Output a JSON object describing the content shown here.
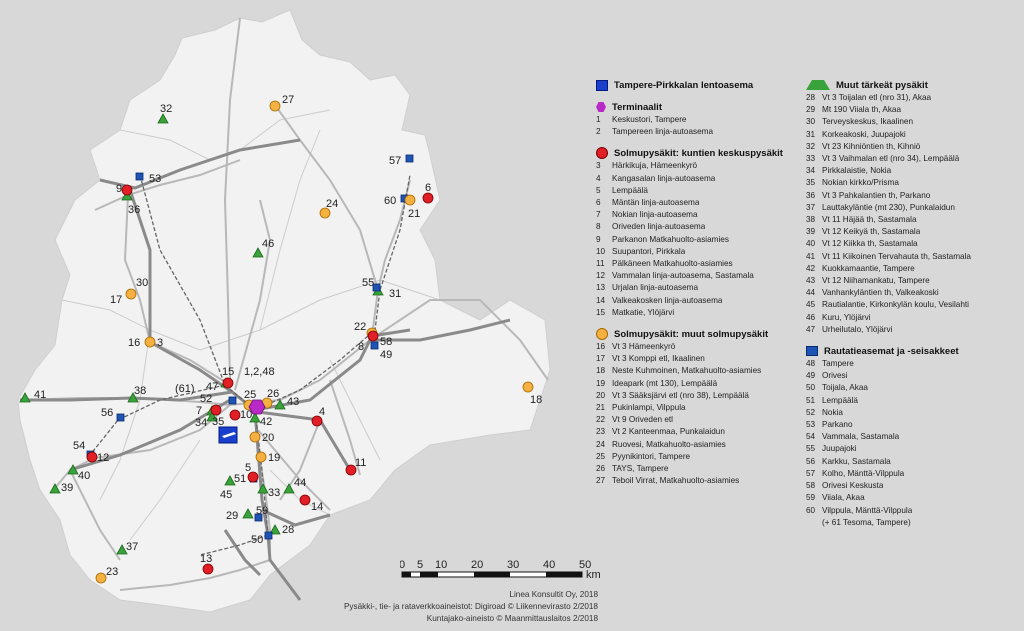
{
  "map": {
    "labels": {
      "n1_2_48": "1,2,48",
      "n61": "(61)",
      "n3": "3",
      "n4": "4",
      "n5": "5",
      "n6": "6",
      "n7": "7",
      "n8": "8",
      "n9": "9",
      "n10": "10",
      "n11": "11",
      "n12": "12",
      "n13": "13",
      "n14": "14",
      "n15": "15",
      "n16": "16",
      "n17": "17",
      "n18": "18",
      "n19": "19",
      "n20": "20",
      "n21": "21",
      "n22": "22",
      "n23": "23",
      "n24": "24",
      "n25": "25",
      "n26": "26",
      "n27": "27",
      "n28": "28",
      "n29": "29",
      "n30": "30",
      "n31": "31",
      "n32": "32",
      "n33": "33",
      "n34": "34",
      "n35": "35",
      "n36": "36",
      "n37": "37",
      "n38": "38",
      "n39": "39",
      "n40": "40",
      "n41": "41",
      "n42": "42",
      "n43": "43",
      "n44": "44",
      "n45": "45",
      "n46": "46",
      "n47": "47",
      "n49": "49",
      "n50": "50",
      "n51": "51",
      "n52": "52",
      "n53": "53",
      "n54": "54",
      "n55": "55",
      "n56": "56",
      "n57": "57",
      "n58": "58",
      "n59": "59",
      "n60": "60"
    }
  },
  "legend": {
    "airport": {
      "title": "Tampere-Pirkkalan lentoasema"
    },
    "terminals": {
      "title": "Terminaalit",
      "items": [
        {
          "n": "1",
          "t": "Keskustori, Tampere"
        },
        {
          "n": "2",
          "t": "Tampereen linja-autoasema"
        }
      ]
    },
    "hubs": {
      "title": "Solmupysäkit: kuntien keskuspysäkit",
      "items": [
        {
          "n": "3",
          "t": "Härkikuja, Hämeenkyrö"
        },
        {
          "n": "4",
          "t": "Kangasalan linja-autoasema"
        },
        {
          "n": "5",
          "t": "Lempäälä"
        },
        {
          "n": "6",
          "t": "Mäntän linja-autoasema"
        },
        {
          "n": "7",
          "t": "Nokian linja-autoasema"
        },
        {
          "n": "8",
          "t": "Oriveden linja-autoasema"
        },
        {
          "n": "9",
          "t": "Parkanon Matkahuolto-asiamies"
        },
        {
          "n": "10",
          "t": "Suupantori, Pirkkala"
        },
        {
          "n": "11",
          "t": "Pälkäneen Matkahuolto-asiamies"
        },
        {
          "n": "12",
          "t": "Vammalan linja-autoasema, Sastamala"
        },
        {
          "n": "13",
          "t": "Urjalan linja-autoasema"
        },
        {
          "n": "14",
          "t": "Valkeakosken linja-autoasema"
        },
        {
          "n": "15",
          "t": "Matkatie, Ylöjärvi"
        }
      ]
    },
    "other_hubs": {
      "title": "Solmupysäkit: muut solmupysäkit",
      "items": [
        {
          "n": "16",
          "t": "Vt 3 Hämeenkyrö"
        },
        {
          "n": "17",
          "t": "Vt 3 Komppi etl, Ikaalinen"
        },
        {
          "n": "18",
          "t": "Neste Kuhmoinen, Matkahuolto-asiamies"
        },
        {
          "n": "19",
          "t": "Ideapark (mt 130), Lempäälä"
        },
        {
          "n": "20",
          "t": "Vt 3 Sääksjärvi etl (nro 38), Lempäälä"
        },
        {
          "n": "21",
          "t": "Pukinlampi, Vilppula"
        },
        {
          "n": "22",
          "t": "Vt 9 Oriveden etl"
        },
        {
          "n": "23",
          "t": "Vt 2 Kanteenmaa, Punkalaidun"
        },
        {
          "n": "24",
          "t": "Ruovesi, Matkahuolto-asiamies"
        },
        {
          "n": "25",
          "t": "Pyynikintori, Tampere"
        },
        {
          "n": "26",
          "t": "TAYS, Tampere"
        },
        {
          "n": "27",
          "t": "Teboil Virrat, Matkahuolto-asiamies"
        }
      ]
    },
    "important": {
      "title": "Muut tärkeät pysäkit",
      "items": [
        {
          "n": "28",
          "t": "Vt 3 Toijalan etl (nro 31), Akaa"
        },
        {
          "n": "29",
          "t": "Mt 190 Viiala th, Akaa"
        },
        {
          "n": "30",
          "t": "Terveyskeskus, Ikaalinen"
        },
        {
          "n": "31",
          "t": "Korkeakoski, Juupajoki"
        },
        {
          "n": "32",
          "t": "Vt 23 Kihniöntien th, Kihniö"
        },
        {
          "n": "33",
          "t": "Vt 3 Vaihmalan etl (nro 34), Lempäälä"
        },
        {
          "n": "34",
          "t": "Pirkkalaistie, Nokia"
        },
        {
          "n": "35",
          "t": "Nokian kirkko/Prisma"
        },
        {
          "n": "36",
          "t": "Vt 3 Pahkalantien th, Parkano"
        },
        {
          "n": "37",
          "t": "Lauttakyläntie (mt 230), Punkalaidun"
        },
        {
          "n": "38",
          "t": "Vt 11 Häjää th, Sastamala"
        },
        {
          "n": "39",
          "t": "Vt 12 Keikyä th, Sastamala"
        },
        {
          "n": "40",
          "t": "Vt 12 Kiikka th, Sastamala"
        },
        {
          "n": "41",
          "t": "Vt 11 Kiikoinen Tervahauta th, Sastamala"
        },
        {
          "n": "42",
          "t": "Kuokkamaantie, Tampere"
        },
        {
          "n": "43",
          "t": "Vt 12 Niihamankatu, Tampere"
        },
        {
          "n": "44",
          "t": "Vanhankyläntien th, Valkeakoski"
        },
        {
          "n": "45",
          "t": "Rautialantie, Kirkonkylän koulu, Vesilahti"
        },
        {
          "n": "46",
          "t": "Kuru, Ylöjärvi"
        },
        {
          "n": "47",
          "t": "Urheilutalo, Ylöjärvi"
        }
      ]
    },
    "rail": {
      "title": "Rautatieasemat ja -seisakkeet",
      "items": [
        {
          "n": "48",
          "t": "Tampere"
        },
        {
          "n": "49",
          "t": "Orivesi"
        },
        {
          "n": "50",
          "t": "Toijala, Akaa"
        },
        {
          "n": "51",
          "t": "Lempäälä"
        },
        {
          "n": "52",
          "t": "Nokia"
        },
        {
          "n": "53",
          "t": "Parkano"
        },
        {
          "n": "54",
          "t": "Vammala, Sastamala"
        },
        {
          "n": "55",
          "t": "Juupajoki"
        },
        {
          "n": "56",
          "t": "Karkku, Sastamala"
        },
        {
          "n": "57",
          "t": "Kolho, Mänttä-Vilppula"
        },
        {
          "n": "58",
          "t": "Orivesi Keskusta"
        },
        {
          "n": "59",
          "t": "Viiala, Akaa"
        },
        {
          "n": "60",
          "t": "Vilppula, Mänttä-Vilppula"
        }
      ],
      "extra": "(+ 61 Tesoma, Tampere)"
    }
  },
  "scale": {
    "ticks": [
      "0",
      "5",
      "10",
      "20",
      "30",
      "40",
      "50"
    ],
    "unit": "km"
  },
  "credits": [
    "Linea Konsultit Oy, 2018",
    "Pysäkki-, tie- ja rataverkkoaineistot: Digiroad © Liikennevirasto 2/2018",
    "Kuntajako-aineisto © Maanmittauslaitos 2/2018"
  ],
  "colors": {
    "region": "#f2f2f2",
    "background": "#d8d8d8",
    "red": "#e01f26",
    "orange": "#f4b040",
    "green": "#3aa23a",
    "blue": "#1e54b4",
    "purple": "#b829c8"
  }
}
